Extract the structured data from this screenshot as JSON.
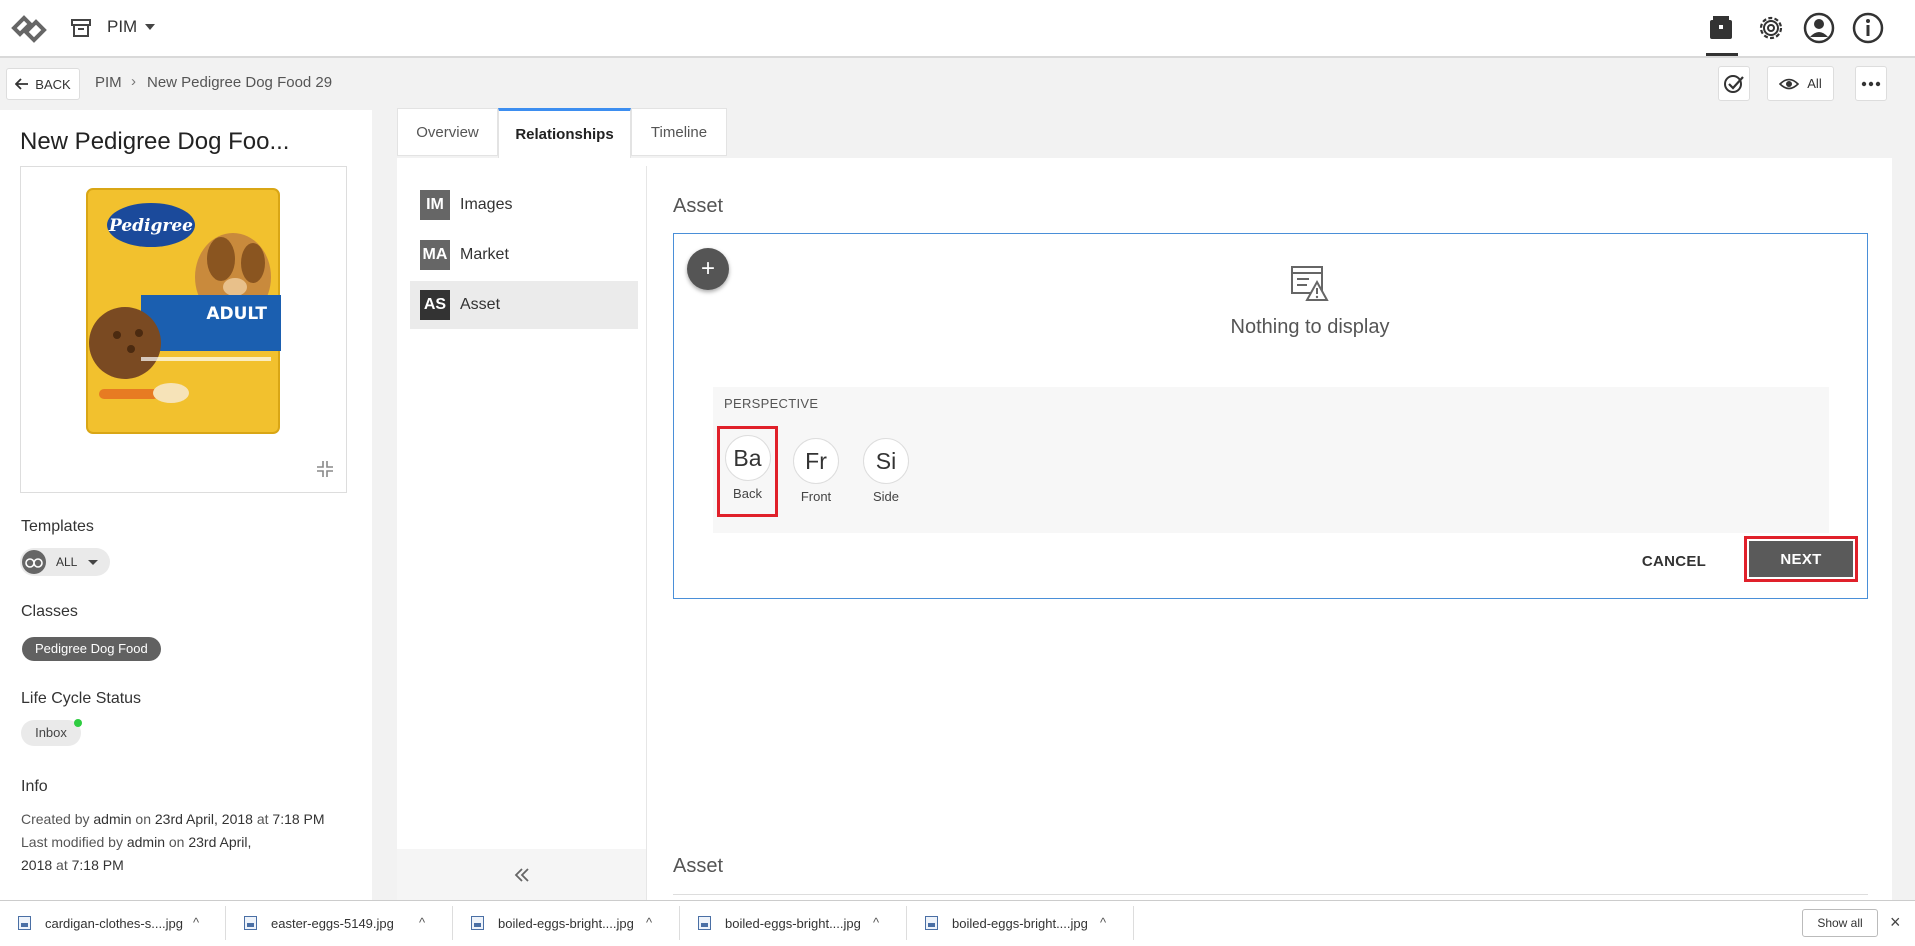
{
  "app": {
    "name": "PIM"
  },
  "breadcrumb": {
    "back_label": "BACK",
    "root": "PIM",
    "separator": "›",
    "current": "New Pedigree Dog Food 29"
  },
  "view_filter": {
    "label": "All"
  },
  "product": {
    "title": "New Pedigree Dog Foo...",
    "image_brand": "Pedigree",
    "image_badge": "ADULT"
  },
  "sidebar": {
    "templates_label": "Templates",
    "templates_value": "ALL",
    "classes_label": "Classes",
    "class_value": "Pedigree Dog Food",
    "lifecycle_label": "Life Cycle Status",
    "lifecycle_value": "Inbox",
    "info_label": "Info",
    "created_prefix": "Created by",
    "created_user": "admin",
    "created_on": "on",
    "created_date": "23rd April, 2018",
    "created_at": "at",
    "created_time": "7:18 PM",
    "modified_prefix": "Last modified by",
    "modified_user": "admin",
    "modified_on": "on",
    "modified_date_1": "23rd April,",
    "modified_date_2": "2018",
    "modified_at": "at",
    "modified_time": "7:18 PM"
  },
  "tabs": [
    {
      "label": "Overview"
    },
    {
      "label": "Relationships"
    },
    {
      "label": "Timeline"
    }
  ],
  "relationships": [
    {
      "badge": "IM",
      "label": "Images"
    },
    {
      "badge": "MA",
      "label": "Market"
    },
    {
      "badge": "AS",
      "label": "Asset"
    }
  ],
  "asset": {
    "heading": "Asset",
    "add_label": "+",
    "empty_text": "Nothing to display",
    "perspective_label": "PERSPECTIVE",
    "perspectives": [
      {
        "abbr": "Ba",
        "name": "Back"
      },
      {
        "abbr": "Fr",
        "name": "Front"
      },
      {
        "abbr": "Si",
        "name": "Side"
      }
    ],
    "cancel_label": "CANCEL",
    "next_label": "NEXT",
    "second_heading": "Asset"
  },
  "downloads": {
    "items": [
      {
        "name": "cardigan-clothes-s....jpg"
      },
      {
        "name": "easter-eggs-5149.jpg"
      },
      {
        "name": "boiled-eggs-bright....jpg"
      },
      {
        "name": "boiled-eggs-bright....jpg"
      },
      {
        "name": "boiled-eggs-bright....jpg"
      }
    ],
    "show_all_label": "Show all",
    "close_label": "×"
  },
  "colors": {
    "accent_blue": "#3d8ef0",
    "highlight_red": "#e0202a",
    "chip_dark": "#616161",
    "status_green": "#2ecc40"
  }
}
